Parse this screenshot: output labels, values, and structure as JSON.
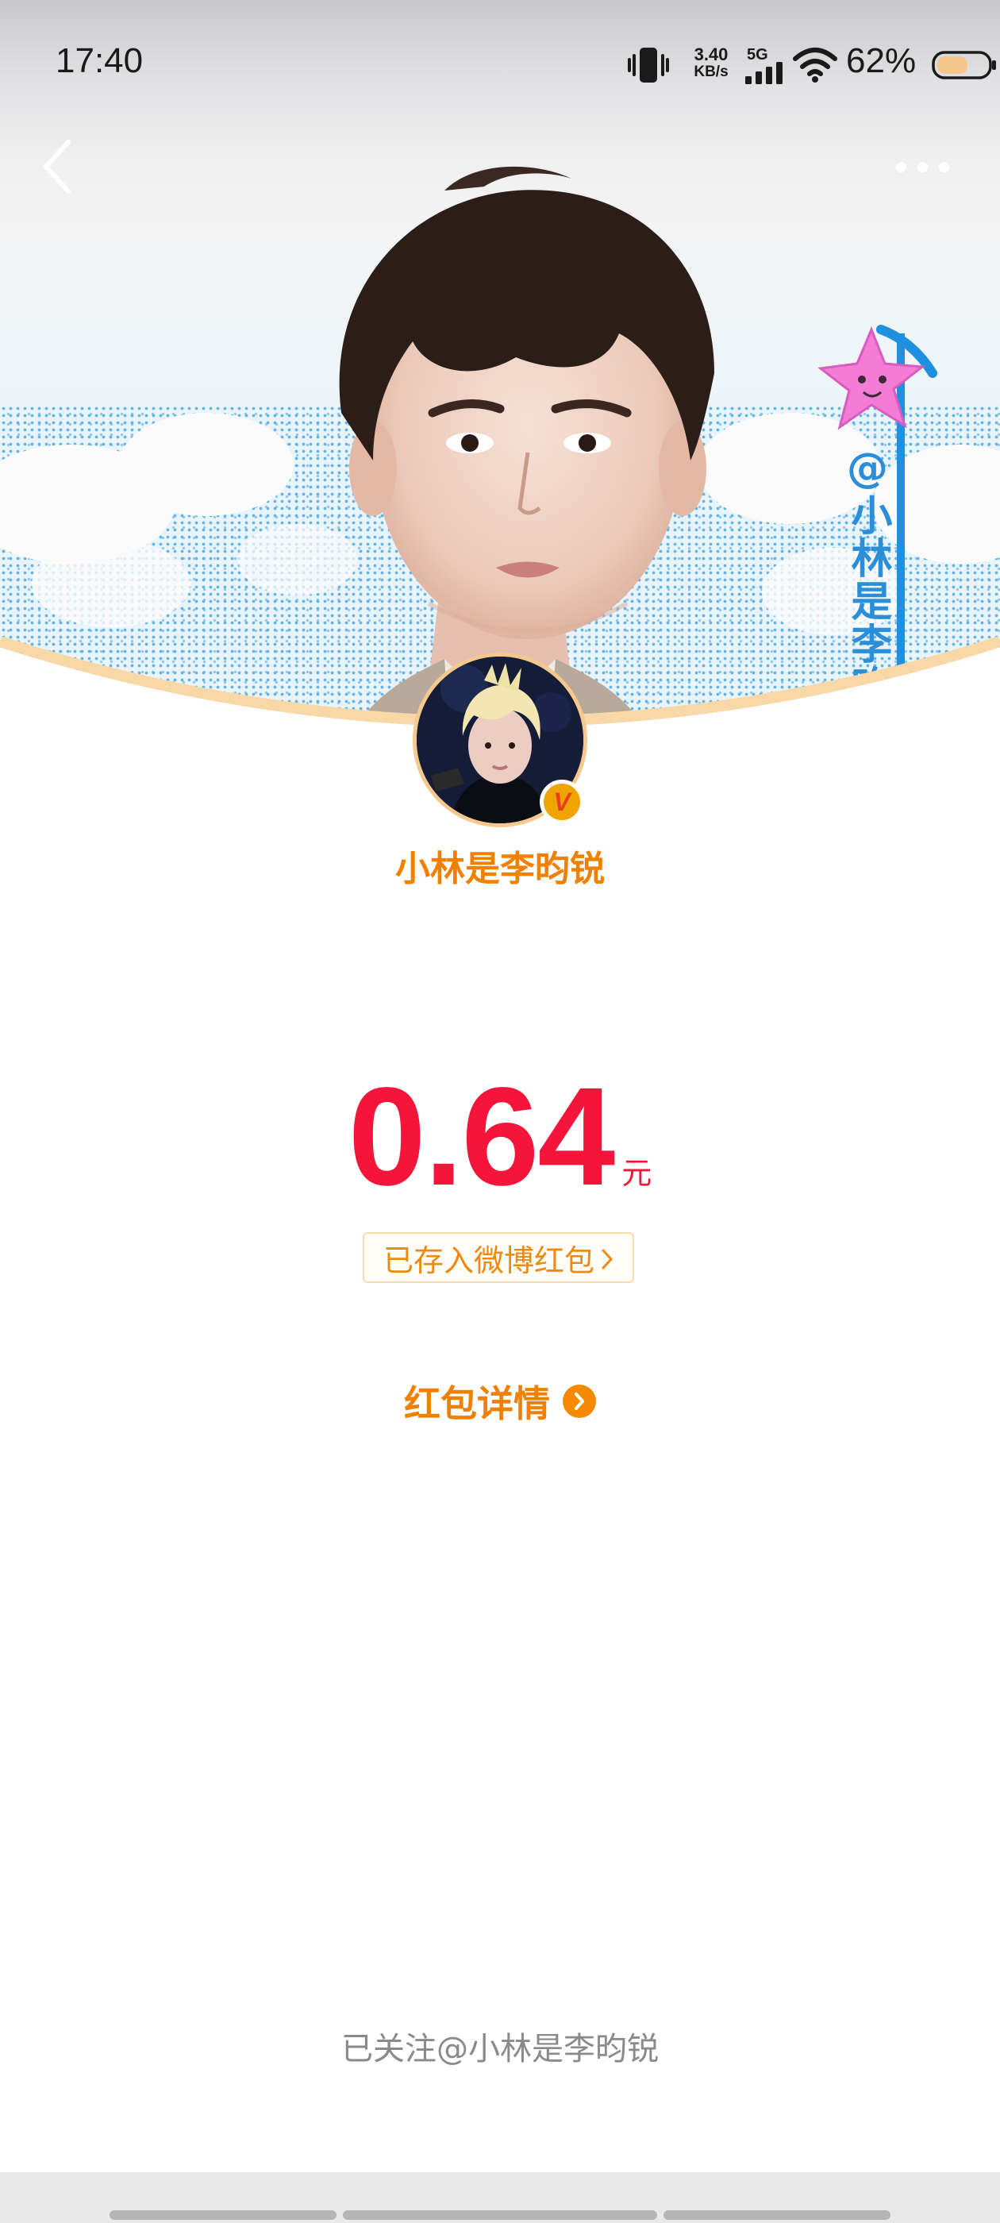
{
  "status_bar": {
    "time": "17:40",
    "net_speed_value": "3.40",
    "net_speed_unit": "KB/s",
    "network_type": "5G",
    "battery_percent": "62%",
    "battery_level": 0.62
  },
  "hero": {
    "mention_tag": "@小林是李昀"
  },
  "sender": {
    "name": "小林是李昀锐",
    "badge": "V"
  },
  "amount": {
    "value": "0.64",
    "unit": "元"
  },
  "deposit": {
    "label": "已存入微博红包"
  },
  "detail": {
    "label": "红包详情"
  },
  "footer": {
    "followed": "已关注@小林是李昀锐"
  },
  "colors": {
    "accent_orange": "#f08000",
    "amount_red": "#f5153a",
    "deposit_border": "#f7dca8",
    "muted_text": "#8a8a8a"
  },
  "icons": {
    "back": "chevron-left-icon",
    "more": "more-dots-icon",
    "detail_arrow": "chevron-right-circle-icon",
    "deposit_arrow": "chevron-right-icon"
  }
}
